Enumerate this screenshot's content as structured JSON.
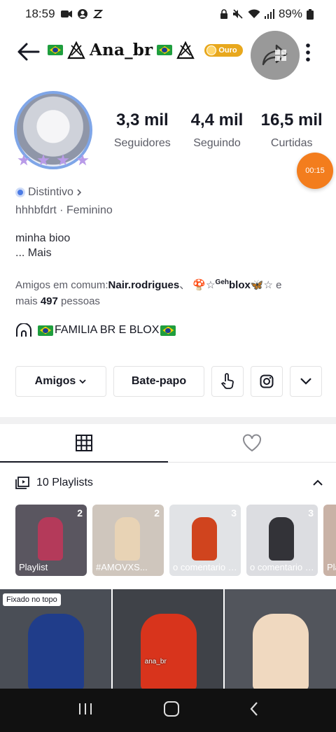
{
  "status_bar": {
    "time": "18:59",
    "battery": "89%"
  },
  "header": {
    "username": "Ana_br",
    "gold_badge": "Ouro"
  },
  "stats": [
    {
      "value": "3,3 mil",
      "label": "Seguidores"
    },
    {
      "value": "4,4 mil",
      "label": "Seguindo"
    },
    {
      "value": "16,5 mil",
      "label": "Curtidas"
    }
  ],
  "timer": "00:15",
  "badge_label": "Distintivo",
  "meta": {
    "handle": "hhhbfdrt",
    "gender": "Feminino"
  },
  "bio": {
    "line1": "minha bioo",
    "more": "...  Mais"
  },
  "friends": {
    "prefix": "Amigos em comum:",
    "name1": "Nair.rodrigues",
    "sep": "、 🍄☆",
    "sup": "Geh",
    "name2": "blox",
    "suffix2": "🦋☆ e",
    "more_prefix": "mais ",
    "count": "497",
    "more_suffix": " pessoas"
  },
  "family": "FAMILIA BR E BLOX",
  "actions": {
    "friends_label": "Amigos",
    "chat_label": "Bate-papo"
  },
  "playlists": {
    "title": "10 Playlists",
    "items": [
      {
        "title": "Playlist",
        "count": "2",
        "bg": "#5a5660",
        "fig": "#b43a5a"
      },
      {
        "title": "#AMOVXS...",
        "count": "2",
        "bg": "#cfc6bd",
        "fig": "#e8d3b5"
      },
      {
        "title": "o comentario mais rosa ga...",
        "count": "3",
        "bg": "#e1e3e6",
        "fig": "#d0441e"
      },
      {
        "title": "o comentario mais vermel...",
        "count": "3",
        "bg": "#dcdde1",
        "fig": "#333338"
      },
      {
        "title": "Pla",
        "count": "",
        "bg": "#c9b2a6",
        "fig": "#a97a6a"
      }
    ]
  },
  "grid": {
    "pinned": "Fixado no topo",
    "cells": [
      {
        "bg": "#4a4e56",
        "fig": "#203d8a",
        "caption": ""
      },
      {
        "bg": "#3f4248",
        "fig": "#d8341c",
        "caption": "ana_br"
      },
      {
        "bg": "#52555c",
        "fig": "#f0d9c0",
        "caption": ""
      }
    ]
  }
}
